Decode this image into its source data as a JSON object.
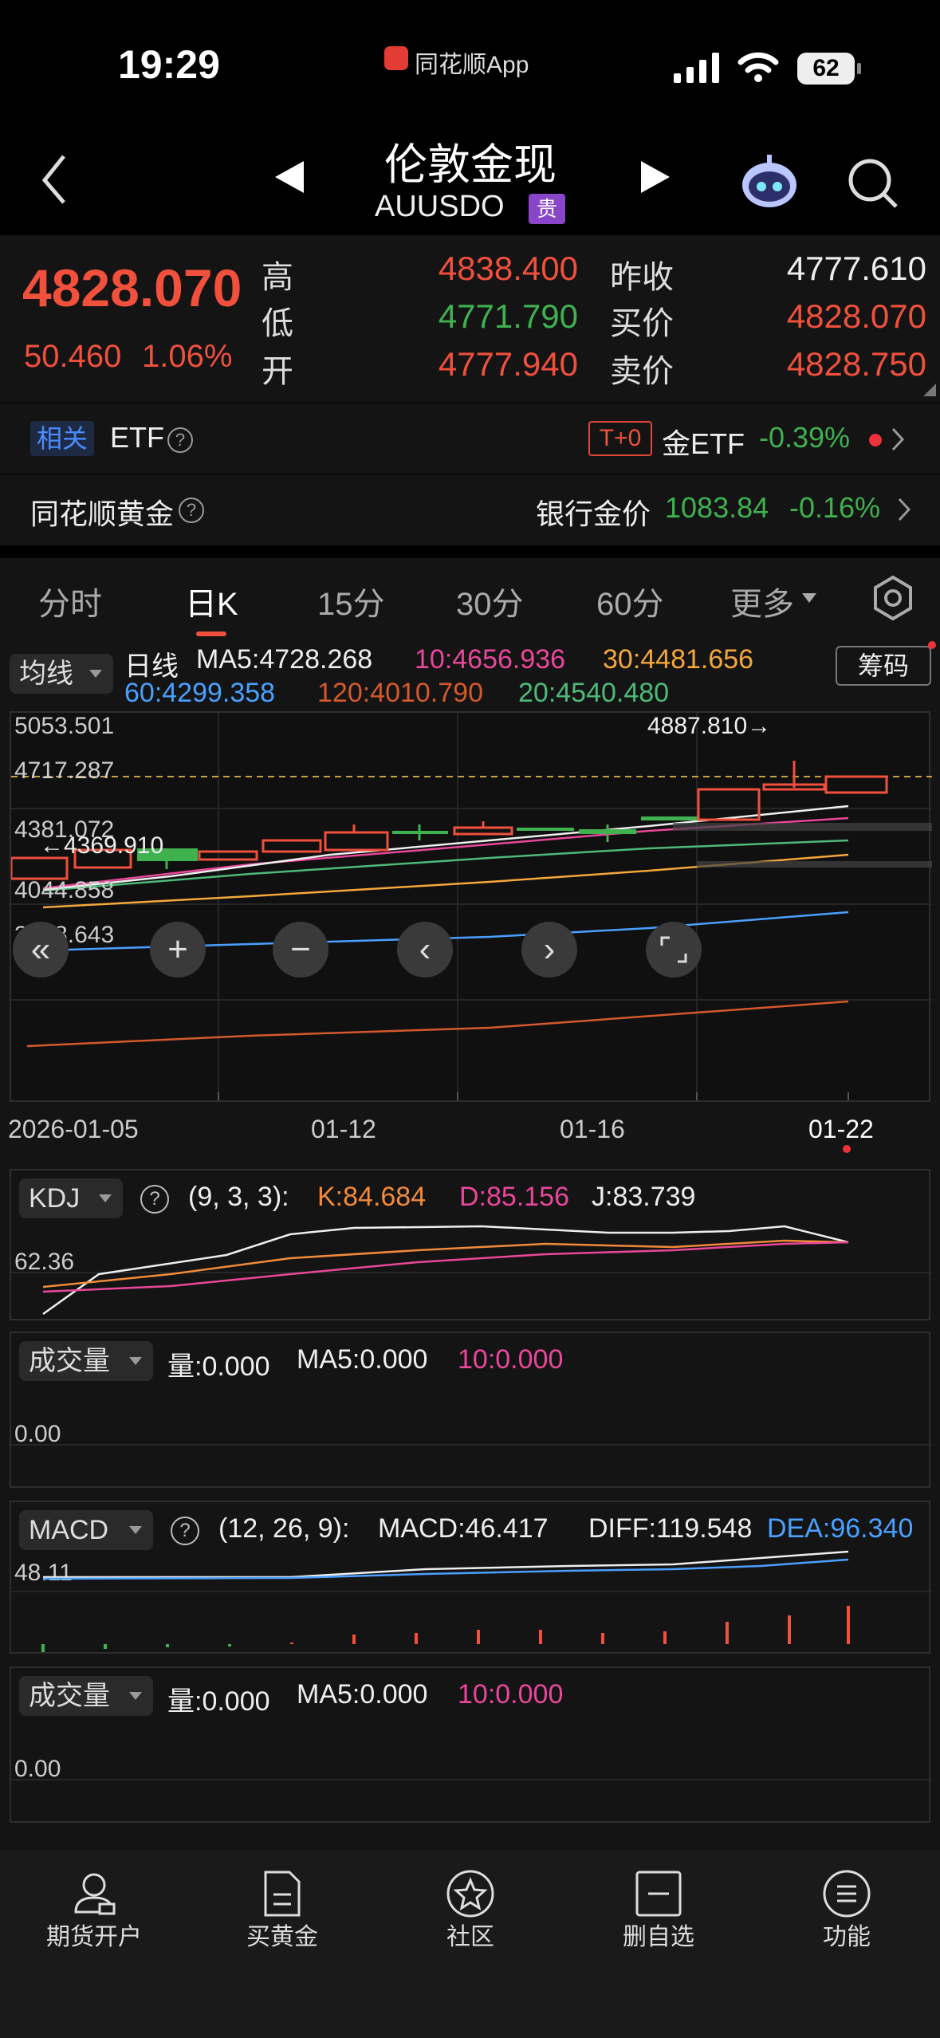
{
  "status": {
    "time": "19:29",
    "app_name": "同花顺App",
    "battery": "62"
  },
  "nav": {
    "title": "伦敦金现",
    "code": "AUUSDO",
    "badge": "贵"
  },
  "quote": {
    "price": "4828.070",
    "change": "50.460",
    "change_pct": "1.06%",
    "high_label": "高",
    "high": "4838.400",
    "low_label": "低",
    "low": "4771.790",
    "open_label": "开",
    "open": "4777.940",
    "prev_close_label": "昨收",
    "prev_close": "4777.610",
    "bid_label": "买价",
    "bid": "4828.070",
    "ask_label": "卖价",
    "ask": "4828.750"
  },
  "etf_row": {
    "tag": "相关",
    "label": "ETF",
    "t0_tag": "T+0",
    "etf_name": "金ETF",
    "etf_change": "-0.39%"
  },
  "gold_row": {
    "label": "同花顺黄金",
    "bank_label": "银行金价",
    "bank_price": "1083.84",
    "bank_change": "-0.16%"
  },
  "tabs": [
    {
      "label": "分时"
    },
    {
      "label": "日K"
    },
    {
      "label": "15分"
    },
    {
      "label": "30分"
    },
    {
      "label": "60分"
    },
    {
      "label": "更多"
    }
  ],
  "main_chart": {
    "indicator": "均线",
    "period": "日线",
    "ma5": "MA5:4728.268",
    "ma10": "10:4656.936",
    "ma30": "30:4481.656",
    "ma60": "60:4299.358",
    "ma120": "120:4010.790",
    "ma20": "20:4540.480",
    "chip_button": "筹码",
    "y_labels": [
      "5053.501",
      "4717.287",
      "4381.072",
      "4044.858",
      "3708.643"
    ],
    "max_marker": "4887.810→",
    "min_marker": "←4369.910",
    "x_labels": [
      "2026-01-05",
      "01-12",
      "01-16",
      "01-22"
    ]
  },
  "kdj": {
    "name": "KDJ",
    "params": "(9, 3, 3):",
    "k": "K:84.684",
    "d": "D:85.156",
    "j": "J:83.739",
    "y_label": "62.36"
  },
  "vol1": {
    "name": "成交量",
    "vol": "量:0.000",
    "ma5": "MA5:0.000",
    "ma10": "10:0.000",
    "y_label": "0.00"
  },
  "macd": {
    "name": "MACD",
    "params": "(12, 26, 9):",
    "macd": "MACD:46.417",
    "diff": "DIFF:119.548",
    "dea": "DEA:96.340",
    "y_label": "48.11"
  },
  "vol2": {
    "name": "成交量",
    "vol": "量:0.000",
    "ma5": "MA5:0.000",
    "ma10": "10:0.000",
    "y_label": "0.00"
  },
  "bottom_nav": [
    {
      "label": "期货开户",
      "icon": "person-icon"
    },
    {
      "label": "买黄金",
      "icon": "document-icon"
    },
    {
      "label": "社区",
      "icon": "star-circle-icon"
    },
    {
      "label": "删自选",
      "icon": "minus-box-icon"
    },
    {
      "label": "功能",
      "icon": "menu-circle-icon"
    }
  ],
  "colors": {
    "up": "#f0503c",
    "down": "#3fb14f",
    "bg": "#141414"
  }
}
